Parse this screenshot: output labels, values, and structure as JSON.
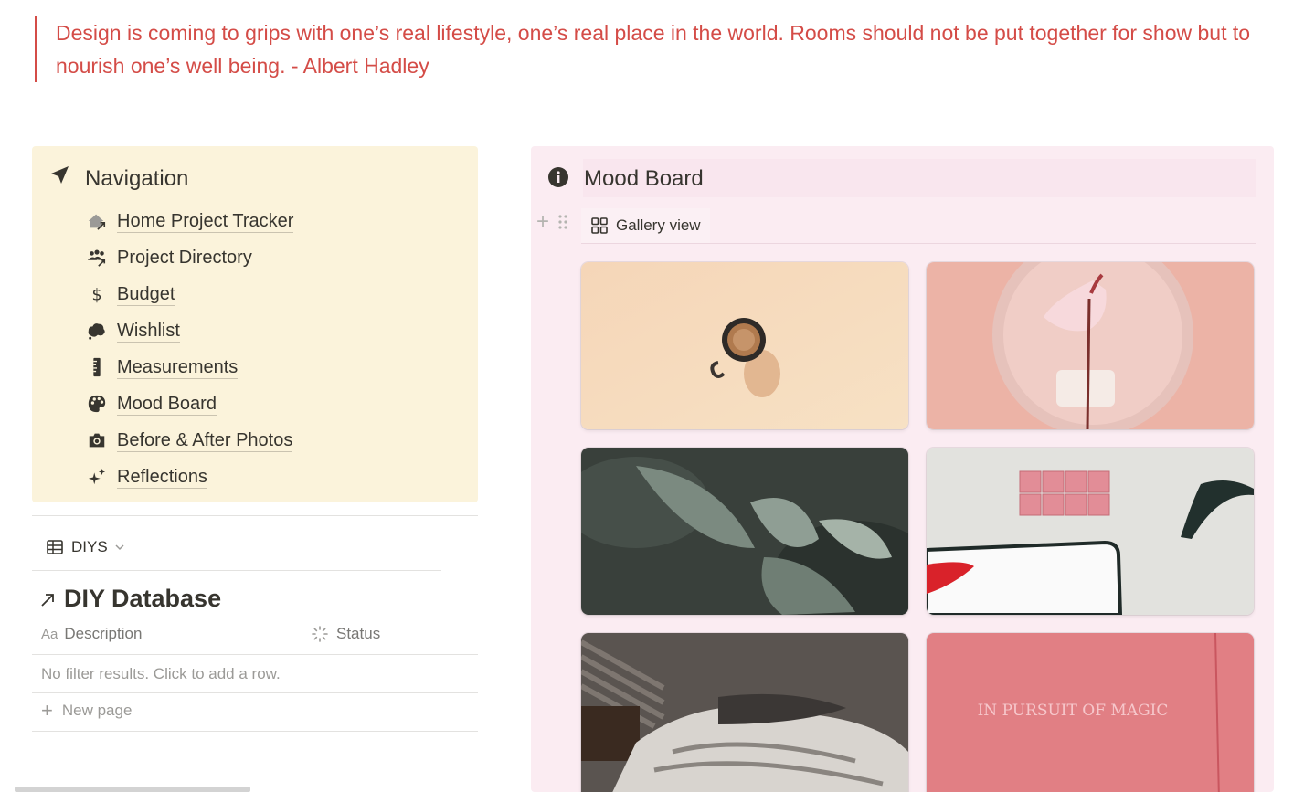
{
  "quote": {
    "text": "Design is coming to grips with one’s real lifestyle, one’s real place in the world. Rooms should not be put together for show but to nourish one’s well being. - Albert Hadley"
  },
  "navigation": {
    "title": "Navigation",
    "icon": "navigation-arrow-icon",
    "items": [
      {
        "label": "Home Project Tracker",
        "icon": "home-link-icon"
      },
      {
        "label": "Project Directory",
        "icon": "people-link-icon"
      },
      {
        "label": "Budget",
        "icon": "dollar-icon"
      },
      {
        "label": "Wishlist",
        "icon": "cloud-icon"
      },
      {
        "label": "Measurements",
        "icon": "ruler-icon"
      },
      {
        "label": "Mood Board",
        "icon": "palette-icon"
      },
      {
        "label": "Before & After Photos",
        "icon": "camera-icon"
      },
      {
        "label": "Reflections",
        "icon": "sparkles-icon"
      }
    ]
  },
  "diys": {
    "view_label": "DIYS",
    "db_title": "DIY Database",
    "columns": {
      "description_prefix": "Aa",
      "description": "Description",
      "status": "Status"
    },
    "empty_text": "No filter results. Click to add a row.",
    "new_page_label": "New page"
  },
  "mood_board": {
    "title": "Mood Board",
    "view_label": "Gallery view",
    "cards": [
      {
        "image": "coffee-cup-photo"
      },
      {
        "image": "pink-flower-plate-photo"
      },
      {
        "image": "green-leaves-photo"
      },
      {
        "image": "pink-tiles-tray-photo"
      },
      {
        "image": "bed-shadows-photo"
      },
      {
        "image": "pink-wall-photo",
        "overlay_text": "IN PURSUIT OF MAGIC"
      }
    ]
  },
  "colors": {
    "quote_accent": "#d44c47",
    "nav_background": "#fbf3db",
    "mood_background": "#fbecf2"
  }
}
